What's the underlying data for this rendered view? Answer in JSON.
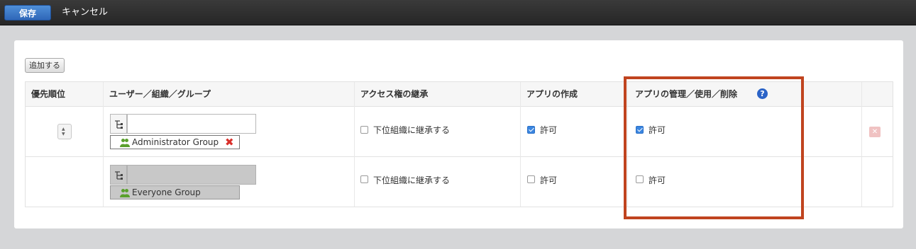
{
  "toolbar": {
    "save_label": "保存",
    "cancel_label": "キャンセル"
  },
  "add_button_label": "追加する",
  "columns": {
    "priority": "優先順位",
    "entity": "ユーザー／組織／グループ",
    "inherit": "アクセス権の継承",
    "create": "アプリの作成",
    "manage": "アプリの管理／使用／削除"
  },
  "help_icon_glyph": "?",
  "rows": [
    {
      "entity_input_value": "",
      "entity_name": "Administrator Group",
      "inherit_label": "下位組織に継承する",
      "inherit_checked": false,
      "create_label": "許可",
      "create_checked": true,
      "manage_label": "許可",
      "manage_checked": true,
      "disabled": false
    },
    {
      "entity_input_value": "",
      "entity_name": "Everyone Group",
      "inherit_label": "下位組織に継承する",
      "inherit_checked": false,
      "create_label": "許可",
      "create_checked": false,
      "manage_label": "許可",
      "manage_checked": false,
      "disabled": true
    }
  ],
  "icons": {
    "tree": "org-tree-icon",
    "group": "group-icon",
    "remove": "remove-icon",
    "help": "help-icon",
    "sort": "sort-icon"
  },
  "colors": {
    "save_button": "#2f67b8",
    "highlight_box": "#c0441f",
    "checkbox_checked": "#3b86e0",
    "remove_icon": "#d9302b"
  }
}
